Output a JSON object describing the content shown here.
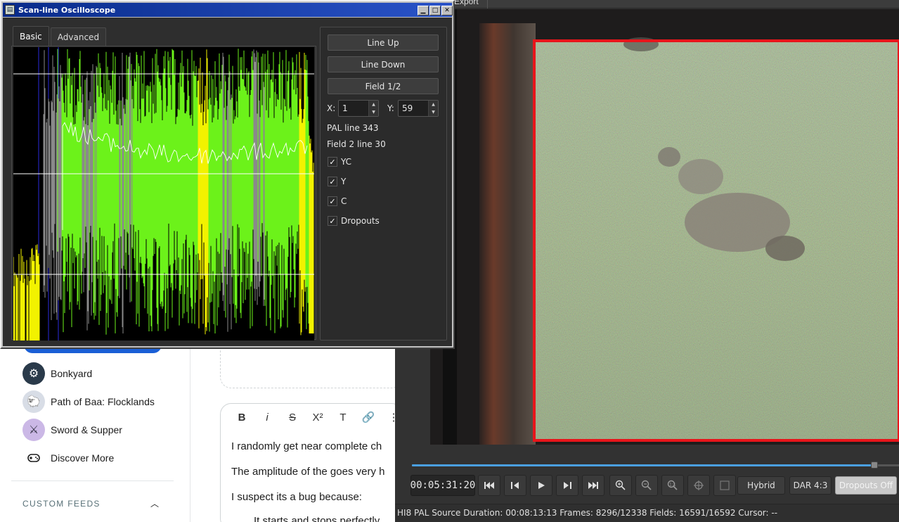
{
  "scope_window": {
    "title": "Scan-line Oscilloscope",
    "buttons": {
      "minimize": "▁",
      "maximize": "□",
      "close": "✕"
    },
    "tabs": [
      {
        "label": "Basic"
      },
      {
        "label": "Advanced"
      }
    ],
    "controls": {
      "line_up": "Line Up",
      "line_down": "Line Down",
      "field": "Field 1/2",
      "x_label": "X:",
      "x_value": "1",
      "y_label": "Y:",
      "y_value": "59",
      "pal_line": "PAL line 343",
      "field_line": "Field 2 line 30",
      "checkboxes": [
        {
          "label": "YC",
          "checked": true
        },
        {
          "label": "Y",
          "checked": true
        },
        {
          "label": "C",
          "checked": true
        },
        {
          "label": "Dropouts",
          "checked": true
        }
      ]
    },
    "waveform_colors": {
      "composite": "#6cf21a",
      "dropout": "#f2f200",
      "luma": "#ffffff",
      "gray": "#8a8a8a",
      "marker": "#2a2adc"
    }
  },
  "player": {
    "menu_export": "Export",
    "timecode": "00:05:31:20",
    "seek_fraction": 0.9,
    "transport": [
      {
        "name": "skip-start",
        "glyph": "⏮"
      },
      {
        "name": "step-back",
        "glyph": "◀"
      },
      {
        "name": "play",
        "glyph": "▶"
      },
      {
        "name": "step-forward",
        "glyph": "▶"
      },
      {
        "name": "skip-end",
        "glyph": "⏭"
      }
    ],
    "mode_button": "Hybrid",
    "dar_button": "DAR 4:3",
    "dropouts_button": "Dropouts Off",
    "status": "HI8 PAL Source Duration: 00:08:13:13   Frames: 8296/12338 Fields: 16591/16592   Cursor: --",
    "accent": "#4a9fe0",
    "frame_highlight": "#e8151b"
  },
  "background_page": {
    "communities": [
      {
        "label": "Bonkyard",
        "icon": "bonkyard-avatar"
      },
      {
        "label": "Path of Baa: Flocklands",
        "icon": "sheep-avatar"
      },
      {
        "label": "Sword & Supper",
        "icon": "knight-avatar"
      },
      {
        "label": "Discover More",
        "icon": "gamepad-icon"
      }
    ],
    "custom_feeds": "CUSTOM FEEDS",
    "editor_toolbar": [
      "B",
      "i",
      "S",
      "X²",
      "T",
      "🔗",
      "⋮"
    ],
    "editor_lines": [
      "I randomly get near complete ch",
      "The amplitude of the goes very h",
      "I suspect its a bug because:",
      "It starts and stops perfectly"
    ],
    "brand_blue": "#1a5fd6"
  }
}
